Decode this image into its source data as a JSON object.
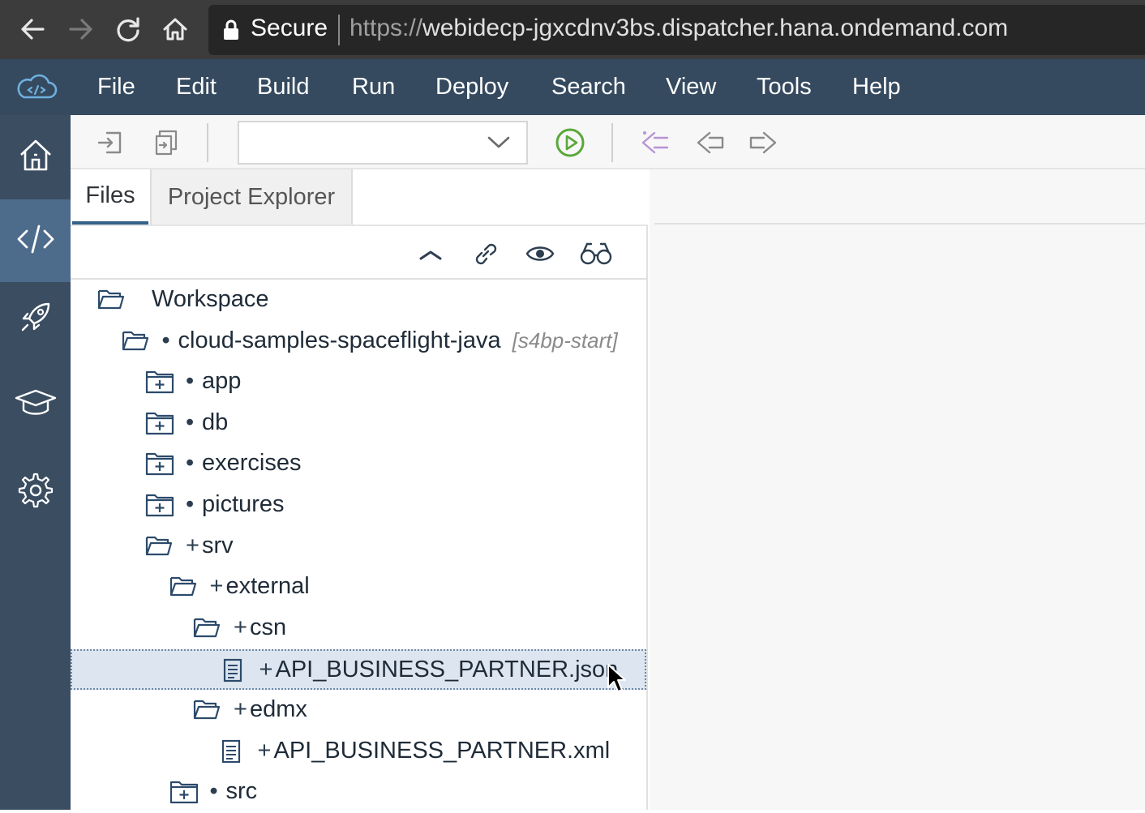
{
  "browser": {
    "back_icon": "arrow-left-icon",
    "forward_icon": "arrow-right-icon",
    "reload_icon": "reload-icon",
    "home_icon": "home-icon",
    "secure_label": "Secure",
    "url_protocol": "https://",
    "url_host": "webidecp-jgxcdnv3bs.dispatcher.hana.ondemand.com"
  },
  "menubar": {
    "items": [
      "File",
      "Edit",
      "Build",
      "Run",
      "Deploy",
      "Search",
      "View",
      "Tools",
      "Help"
    ]
  },
  "rail": {
    "items": [
      "home",
      "development",
      "deploy",
      "learning",
      "settings"
    ],
    "active": "development"
  },
  "toolbar": {
    "run_config_value": "",
    "icons": [
      "import-icon",
      "export-icon",
      "run-icon",
      "last-edit-icon",
      "back-icon",
      "forward-icon"
    ]
  },
  "leftpane": {
    "tabs": [
      {
        "label": "Files",
        "active": true
      },
      {
        "label": "Project Explorer",
        "active": false
      }
    ],
    "tool_icons": [
      "collapse-icon",
      "link-icon",
      "show-hidden-icon",
      "search-icon"
    ]
  },
  "tree": [
    {
      "label": "Workspace",
      "marker": "",
      "branch": "",
      "type": "open-folder",
      "level": 0
    },
    {
      "label": "cloud-samples-spaceflight-java",
      "marker": "•",
      "branch": "[s4bp-start]",
      "type": "open-folder",
      "level": 1
    },
    {
      "label": "app",
      "marker": "•",
      "branch": "",
      "type": "closed-folder",
      "level": 2
    },
    {
      "label": "db",
      "marker": "•",
      "branch": "",
      "type": "closed-folder",
      "level": 2
    },
    {
      "label": "exercises",
      "marker": "•",
      "branch": "",
      "type": "closed-folder",
      "level": 2
    },
    {
      "label": "pictures",
      "marker": "•",
      "branch": "",
      "type": "closed-folder",
      "level": 2
    },
    {
      "label": "srv",
      "marker": "+",
      "branch": "",
      "type": "open-folder",
      "level": 2
    },
    {
      "label": "external",
      "marker": "+",
      "branch": "",
      "type": "open-folder",
      "level": 3
    },
    {
      "label": "csn",
      "marker": "+",
      "branch": "",
      "type": "open-folder",
      "level": 4
    },
    {
      "label": "API_BUSINESS_PARTNER.json",
      "marker": "+",
      "branch": "",
      "type": "file",
      "level": 5,
      "selected": true
    },
    {
      "label": "edmx",
      "marker": "+",
      "branch": "",
      "type": "open-folder",
      "level": 4
    },
    {
      "label": "API_BUSINESS_PARTNER.xml",
      "marker": "+",
      "branch": "",
      "type": "file",
      "level": 5
    },
    {
      "label": "src",
      "marker": "•",
      "branch": "",
      "type": "closed-folder",
      "level": 3
    }
  ],
  "colors": {
    "menubar": "#354a5f",
    "rail": "#3b4d61",
    "rail_active": "#4d6b8b",
    "run_green": "#5aa83a",
    "selection": "#dde6f0"
  }
}
